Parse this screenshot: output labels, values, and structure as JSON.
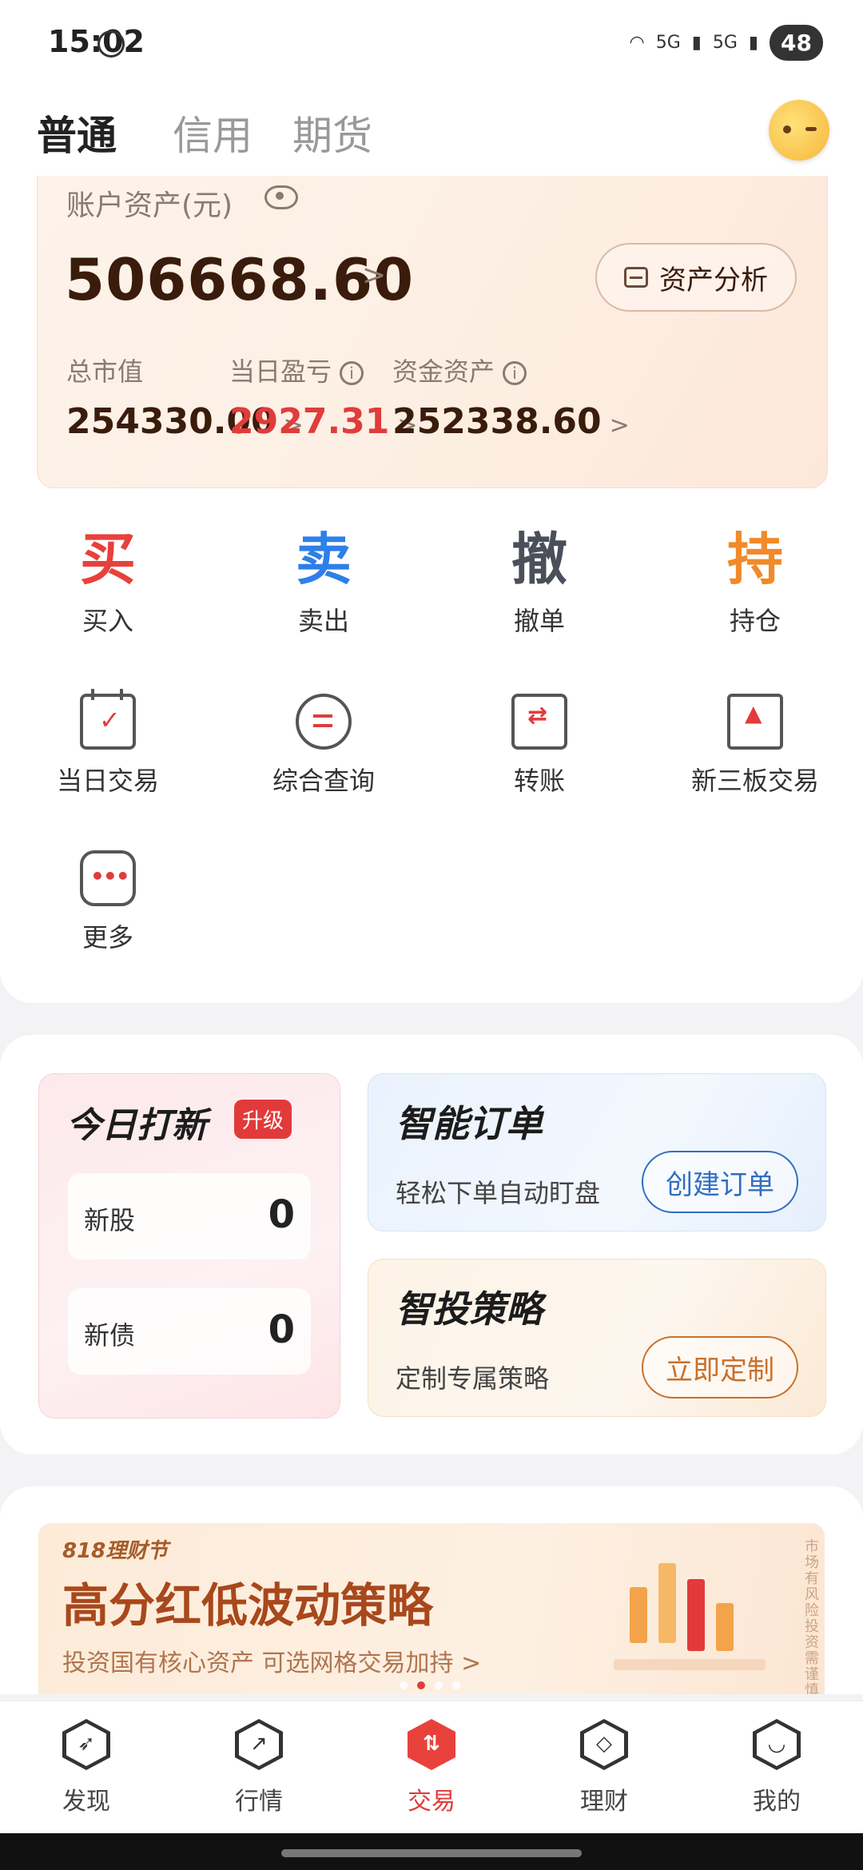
{
  "status_bar": {
    "time": "15:02",
    "net1": "5G",
    "net2": "5G",
    "battery": "48"
  },
  "top_tabs": [
    {
      "label": "普通",
      "active": true
    },
    {
      "label": "信用",
      "active": false
    },
    {
      "label": "期货",
      "active": false
    }
  ],
  "account": {
    "title": "账户资产(元)",
    "total": "506668.60",
    "analysis_label": "资产分析",
    "market_value_label": "总市值",
    "market_value": "254330.00",
    "daily_pnl_label": "当日盈亏",
    "daily_pnl": "2927.31",
    "cash_label": "资金资产",
    "cash": "252338.60",
    "arrow": ">"
  },
  "actions": [
    {
      "glyph": "买",
      "label": "买入",
      "color": "#e8413c"
    },
    {
      "glyph": "卖",
      "label": "卖出",
      "color": "#2e7fe8"
    },
    {
      "glyph": "撤",
      "label": "撤单",
      "color": "#4a4f5a"
    },
    {
      "glyph": "持",
      "label": "持仓",
      "color": "#f08a2a"
    }
  ],
  "functions": [
    {
      "label": "当日交易",
      "icon": "calendar-check-icon"
    },
    {
      "label": "综合查询",
      "icon": "search-query-icon"
    },
    {
      "label": "转账",
      "icon": "transfer-icon"
    },
    {
      "label": "新三板交易",
      "icon": "board-icon"
    },
    {
      "label": "更多",
      "icon": "more-icon"
    }
  ],
  "ipo": {
    "title": "今日打新",
    "badge": "升级",
    "rows": [
      {
        "label": "新股",
        "value": "0"
      },
      {
        "label": "新债",
        "value": "0"
      }
    ]
  },
  "smart_order": {
    "title": "智能订单",
    "subtitle": "轻松下单自动盯盘",
    "button": "创建订单",
    "accent": "#2f6fbf"
  },
  "smart_strategy": {
    "title": "智投策略",
    "subtitle": "定制专属策略",
    "button": "立即定制",
    "accent": "#c8702a"
  },
  "banner": {
    "tag": "818理财节",
    "title": "高分红低波动策略",
    "subtitle": "投资国有核心资产 可选网格交易加持 >",
    "side_note": "市场有风险 投资需谨慎"
  },
  "bottom_nav": [
    {
      "label": "发现",
      "icon": "compass-icon",
      "glyph": "➶",
      "active": false
    },
    {
      "label": "行情",
      "icon": "trend-icon",
      "glyph": "↗",
      "active": false
    },
    {
      "label": "交易",
      "icon": "trade-icon",
      "glyph": "⇅",
      "active": true
    },
    {
      "label": "理财",
      "icon": "wealth-icon",
      "glyph": "◇",
      "active": false
    },
    {
      "label": "我的",
      "icon": "profile-icon",
      "glyph": "◡",
      "active": false
    }
  ]
}
